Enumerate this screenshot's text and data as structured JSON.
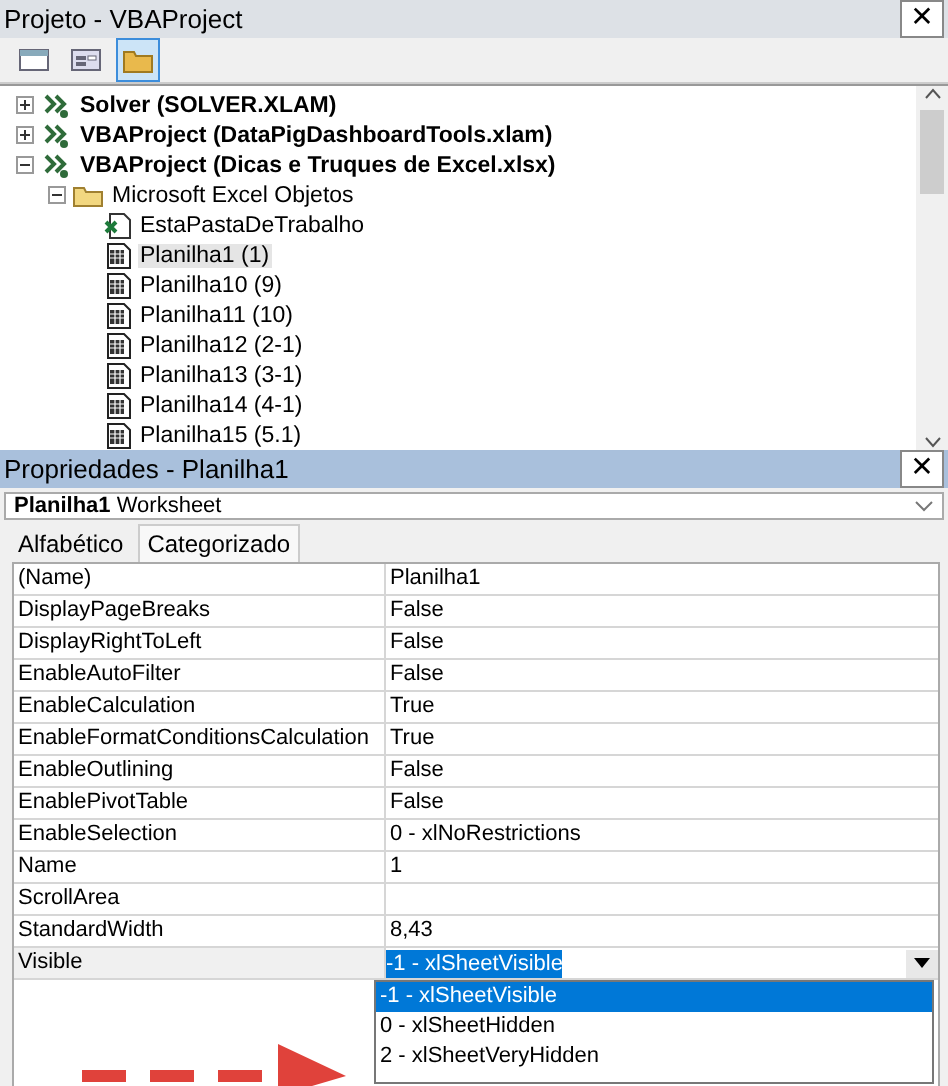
{
  "project_panel": {
    "title": "Projeto - VBAProject",
    "close": "✕",
    "toolbar": [
      {
        "kind": "code",
        "selected": false
      },
      {
        "kind": "object",
        "selected": false
      },
      {
        "kind": "folder",
        "selected": true
      }
    ],
    "tree": [
      {
        "kind": "project",
        "label": "Solver (SOLVER.XLAM)",
        "expanded": false,
        "selected": false
      },
      {
        "kind": "project",
        "label": "VBAProject (DataPigDashboardTools.xlam)",
        "expanded": false,
        "selected": false
      },
      {
        "kind": "project",
        "label": "VBAProject (Dicas e Truques de Excel.xlsx)",
        "expanded": true,
        "selected": false,
        "children": [
          {
            "kind": "folder",
            "label": "Microsoft Excel Objetos",
            "expanded": true,
            "selected": false,
            "children": [
              {
                "kind": "workbook",
                "label": "EstaPastaDeTrabalho",
                "selected": false
              },
              {
                "kind": "sheet",
                "label": "Planilha1 (1)",
                "selected": true
              },
              {
                "kind": "sheet",
                "label": "Planilha10 (9)",
                "selected": false
              },
              {
                "kind": "sheet",
                "label": "Planilha11 (10)",
                "selected": false
              },
              {
                "kind": "sheet",
                "label": "Planilha12 (2-1)",
                "selected": false
              },
              {
                "kind": "sheet",
                "label": "Planilha13 (3-1)",
                "selected": false
              },
              {
                "kind": "sheet",
                "label": "Planilha14 (4-1)",
                "selected": false
              },
              {
                "kind": "sheet",
                "label": "Planilha15 (5.1)",
                "selected": false
              }
            ]
          }
        ]
      }
    ]
  },
  "properties_panel": {
    "title": "Propriedades - Planilha1",
    "close": "✕",
    "object": {
      "name": "Planilha1",
      "type": "Worksheet"
    },
    "tabs": [
      {
        "label": "Alfabético",
        "selected": true
      },
      {
        "label": "Categorizado",
        "selected": false
      }
    ],
    "rows": [
      {
        "name": "(Name)",
        "value": "Planilha1",
        "selected": false
      },
      {
        "name": "DisplayPageBreaks",
        "value": "False",
        "selected": false
      },
      {
        "name": "DisplayRightToLeft",
        "value": "False",
        "selected": false
      },
      {
        "name": "EnableAutoFilter",
        "value": "False",
        "selected": false
      },
      {
        "name": "EnableCalculation",
        "value": "True",
        "selected": false
      },
      {
        "name": "EnableFormatConditionsCalculation",
        "value": "True",
        "selected": false
      },
      {
        "name": "EnableOutlining",
        "value": "False",
        "selected": false
      },
      {
        "name": "EnablePivotTable",
        "value": "False",
        "selected": false
      },
      {
        "name": "EnableSelection",
        "value": "0 - xlNoRestrictions",
        "selected": false
      },
      {
        "name": "Name",
        "value": "1",
        "selected": false
      },
      {
        "name": "ScrollArea",
        "value": "",
        "selected": false
      },
      {
        "name": "StandardWidth",
        "value": "8,43",
        "selected": false
      },
      {
        "name": "Visible",
        "value": "-1 - xlSheetVisible",
        "selected": true,
        "options": [
          {
            "label": "-1 - xlSheetVisible",
            "selected": true
          },
          {
            "label": "0 - xlSheetHidden",
            "selected": false
          },
          {
            "label": "2 - xlSheetVeryHidden",
            "selected": false
          }
        ]
      }
    ]
  }
}
